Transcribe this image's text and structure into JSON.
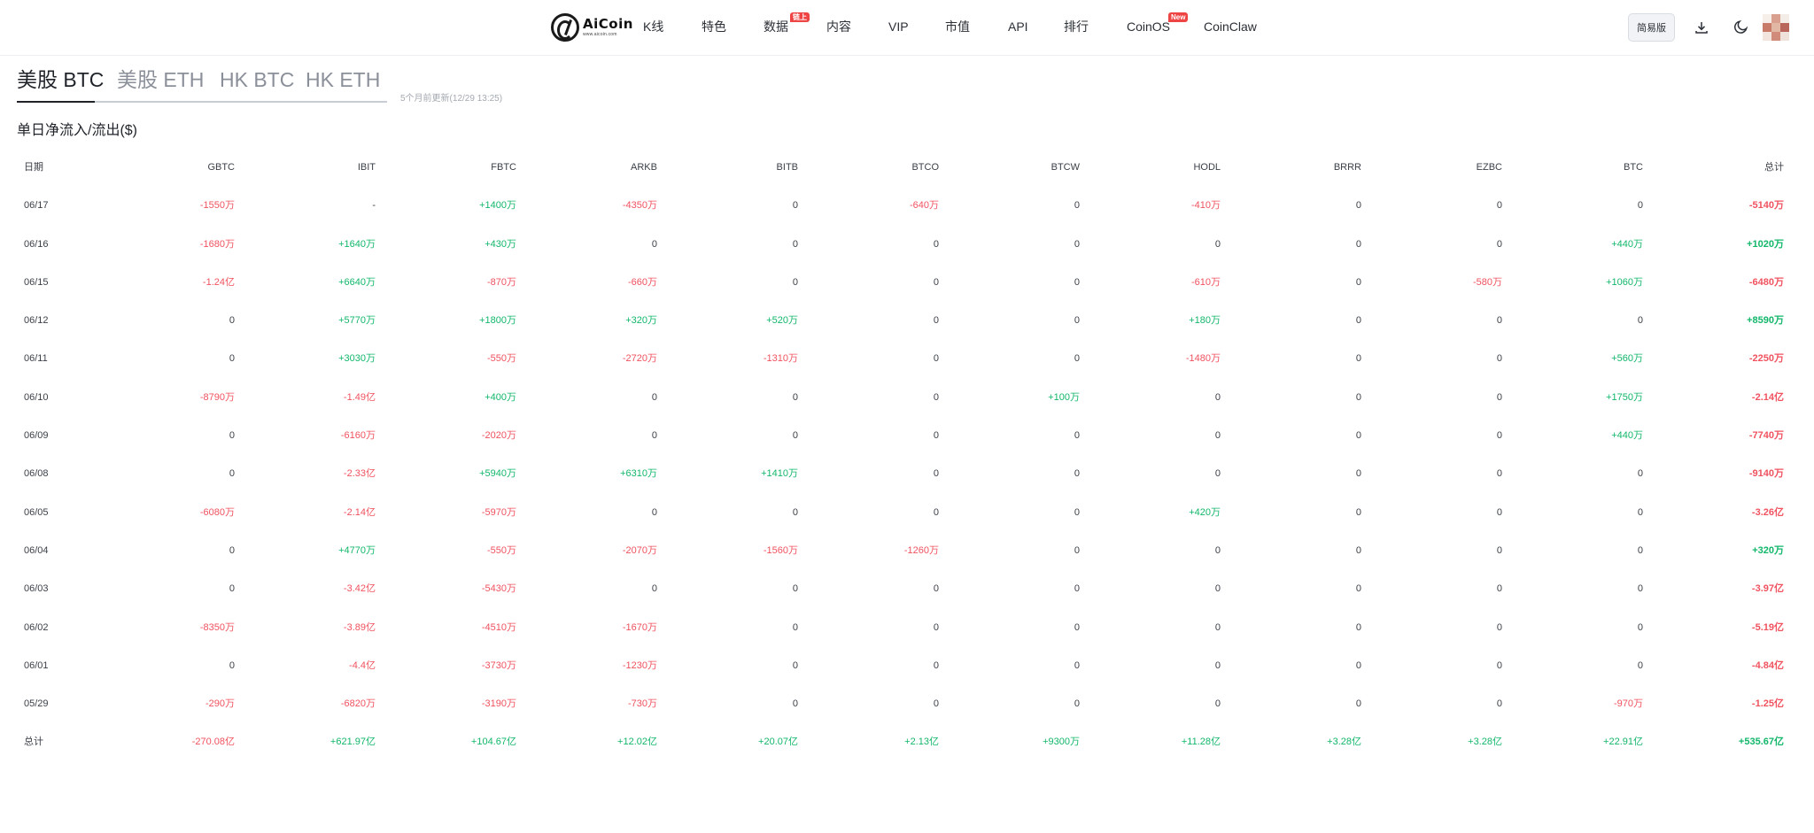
{
  "header": {
    "logo": {
      "name": "AiCoin",
      "sub": "www.aicoin.com"
    },
    "nav": [
      {
        "label": "K线",
        "badge": ""
      },
      {
        "label": "特色",
        "badge": ""
      },
      {
        "label": "数据",
        "badge": "链上"
      },
      {
        "label": "内容",
        "badge": ""
      },
      {
        "label": "VIP",
        "badge": ""
      },
      {
        "label": "市值",
        "badge": ""
      },
      {
        "label": "API",
        "badge": ""
      },
      {
        "label": "排行",
        "badge": ""
      },
      {
        "label": "CoinOS",
        "badge": "New"
      },
      {
        "label": "CoinClaw",
        "badge": ""
      }
    ],
    "simple_mode_label": "简易版",
    "icons": [
      "download-icon",
      "moon-icon"
    ]
  },
  "tabs": [
    "美股 BTC",
    "美股 ETH",
    "HK BTC",
    "HK ETH"
  ],
  "active_tab": 0,
  "update_note": "5个月前更新(12/29 13:25)",
  "section_title": "单日净流入/流出($)",
  "colors": {
    "positive": "#12b76a",
    "negative": "#f0525f",
    "neutral": "#3a3f47"
  },
  "table": {
    "columns": [
      "日期",
      "GBTC",
      "IBIT",
      "FBTC",
      "ARKB",
      "BITB",
      "BTCO",
      "BTCW",
      "HODL",
      "BRRR",
      "EZBC",
      "BTC",
      "总计"
    ],
    "rows": [
      [
        "06/17",
        "-1550万",
        "-",
        "+1400万",
        "-4350万",
        "0",
        "-640万",
        "0",
        "-410万",
        "0",
        "0",
        "0",
        "-5140万"
      ],
      [
        "06/16",
        "-1680万",
        "+1640万",
        "+430万",
        "0",
        "0",
        "0",
        "0",
        "0",
        "0",
        "0",
        "+440万",
        "+1020万"
      ],
      [
        "06/15",
        "-1.24亿",
        "+6640万",
        "-870万",
        "-660万",
        "0",
        "0",
        "0",
        "-610万",
        "0",
        "-580万",
        "+1060万",
        "-6480万"
      ],
      [
        "06/12",
        "0",
        "+5770万",
        "+1800万",
        "+320万",
        "+520万",
        "0",
        "0",
        "+180万",
        "0",
        "0",
        "0",
        "+8590万"
      ],
      [
        "06/11",
        "0",
        "+3030万",
        "-550万",
        "-2720万",
        "-1310万",
        "0",
        "0",
        "-1480万",
        "0",
        "0",
        "+560万",
        "-2250万"
      ],
      [
        "06/10",
        "-8790万",
        "-1.49亿",
        "+400万",
        "0",
        "0",
        "0",
        "+100万",
        "0",
        "0",
        "0",
        "+1750万",
        "-2.14亿"
      ],
      [
        "06/09",
        "0",
        "-6160万",
        "-2020万",
        "0",
        "0",
        "0",
        "0",
        "0",
        "0",
        "0",
        "+440万",
        "-7740万"
      ],
      [
        "06/08",
        "0",
        "-2.33亿",
        "+5940万",
        "+6310万",
        "+1410万",
        "0",
        "0",
        "0",
        "0",
        "0",
        "0",
        "-9140万"
      ],
      [
        "06/05",
        "-6080万",
        "-2.14亿",
        "-5970万",
        "0",
        "0",
        "0",
        "0",
        "+420万",
        "0",
        "0",
        "0",
        "-3.26亿"
      ],
      [
        "06/04",
        "0",
        "+4770万",
        "-550万",
        "-2070万",
        "-1560万",
        "-1260万",
        "0",
        "0",
        "0",
        "0",
        "0",
        "+320万"
      ],
      [
        "06/03",
        "0",
        "-3.42亿",
        "-5430万",
        "0",
        "0",
        "0",
        "0",
        "0",
        "0",
        "0",
        "0",
        "-3.97亿"
      ],
      [
        "06/02",
        "-8350万",
        "-3.89亿",
        "-4510万",
        "-1670万",
        "0",
        "0",
        "0",
        "0",
        "0",
        "0",
        "0",
        "-5.19亿"
      ],
      [
        "06/01",
        "0",
        "-4.4亿",
        "-3730万",
        "-1230万",
        "0",
        "0",
        "0",
        "0",
        "0",
        "0",
        "0",
        "-4.84亿"
      ],
      [
        "05/29",
        "-290万",
        "-6820万",
        "-3190万",
        "-730万",
        "0",
        "0",
        "0",
        "0",
        "0",
        "0",
        "-970万",
        "-1.25亿"
      ]
    ],
    "total_row": [
      "总计",
      "-270.08亿",
      "+621.97亿",
      "+104.67亿",
      "+12.02亿",
      "+20.07亿",
      "+2.13亿",
      "+9300万",
      "+11.28亿",
      "+3.28亿",
      "+3.28亿",
      "+22.91亿",
      "+535.67亿"
    ]
  }
}
